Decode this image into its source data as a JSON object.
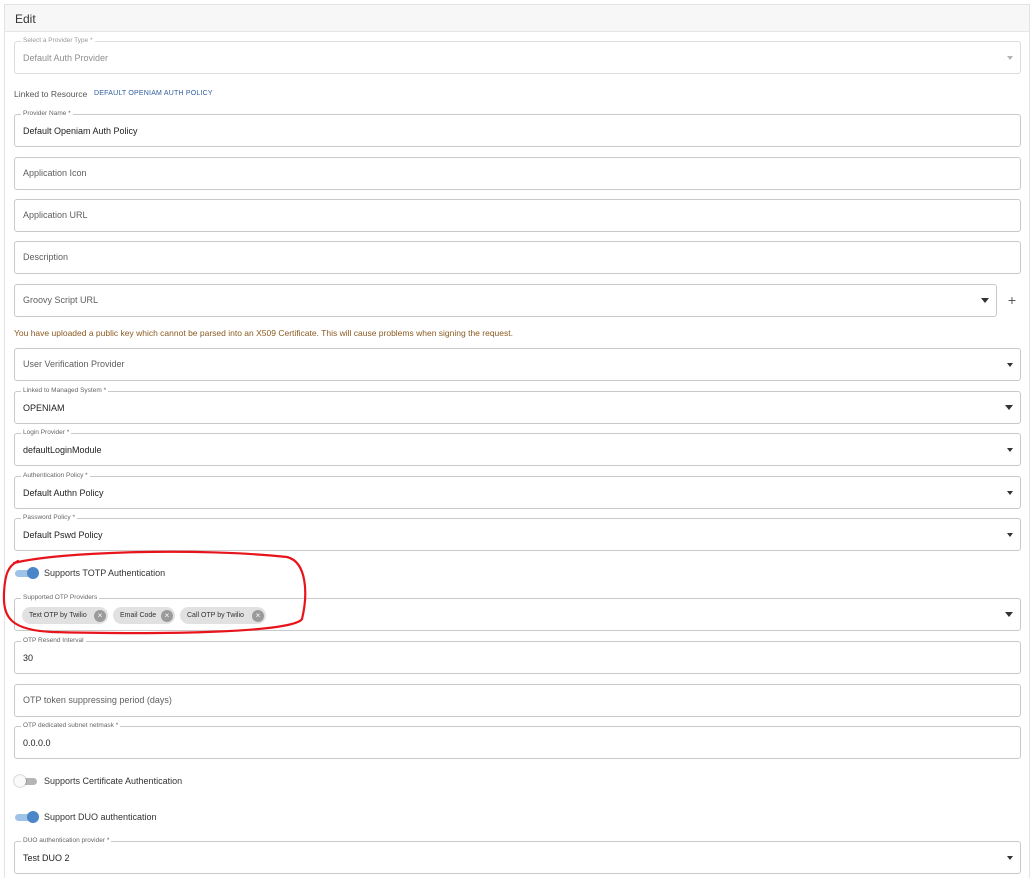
{
  "header": {
    "title": "Edit"
  },
  "provider_type": {
    "label": "Select a Provider Type *",
    "value": "Default Auth Provider"
  },
  "linked_resource": {
    "label": "Linked to Resource",
    "link": "DEFAULT OPENIAM AUTH POLICY"
  },
  "provider_name": {
    "label": "Provider Name *",
    "value": "Default Openiam Auth Policy"
  },
  "application_icon": {
    "placeholder": "Application Icon"
  },
  "application_url": {
    "placeholder": "Application URL"
  },
  "description": {
    "placeholder": "Description"
  },
  "groovy_script": {
    "placeholder": "Groovy Script URL",
    "add_label": "+"
  },
  "warning": "You have uploaded a public key which cannot be parsed into an X509 Certificate. This will cause problems when signing the request.",
  "user_verification": {
    "placeholder": "User Verification Provider"
  },
  "managed_system": {
    "label": "Linked to Managed System *",
    "value": "OPENIAM"
  },
  "login_provider": {
    "label": "Login Provider *",
    "value": "defaultLoginModule"
  },
  "authentication_policy": {
    "label": "Authentication Policy *",
    "value": "Default Authn Policy"
  },
  "password_policy": {
    "label": "Password Policy *",
    "value": "Default Pswd Policy"
  },
  "totp": {
    "label": "Supports TOTP Authentication",
    "enabled": true
  },
  "otp_providers": {
    "label": "Supported OTP Providers",
    "chips": [
      {
        "label": "Text OTP by Twilio"
      },
      {
        "label": "Email Code"
      },
      {
        "label": "Call OTP by Twilio"
      }
    ]
  },
  "otp_resend": {
    "label": "OTP Resend Interval",
    "value": "30"
  },
  "otp_suppress": {
    "placeholder": "OTP token suppressing period (days)"
  },
  "otp_subnet": {
    "label": "OTP dedicated subnet netmask *",
    "value": "0.0.0.0"
  },
  "certificate": {
    "label": "Supports Certificate Authentication",
    "enabled": false
  },
  "duo": {
    "label": "Support DUO authentication",
    "enabled": true
  },
  "duo_provider": {
    "label": "DUO authentication provider *",
    "value": "Test DUO 2"
  },
  "colors": {
    "toggle_on": "#4a86c8",
    "link": "#2f5d9e",
    "warning": "#8a5a20",
    "annotation": "#e8141c"
  }
}
